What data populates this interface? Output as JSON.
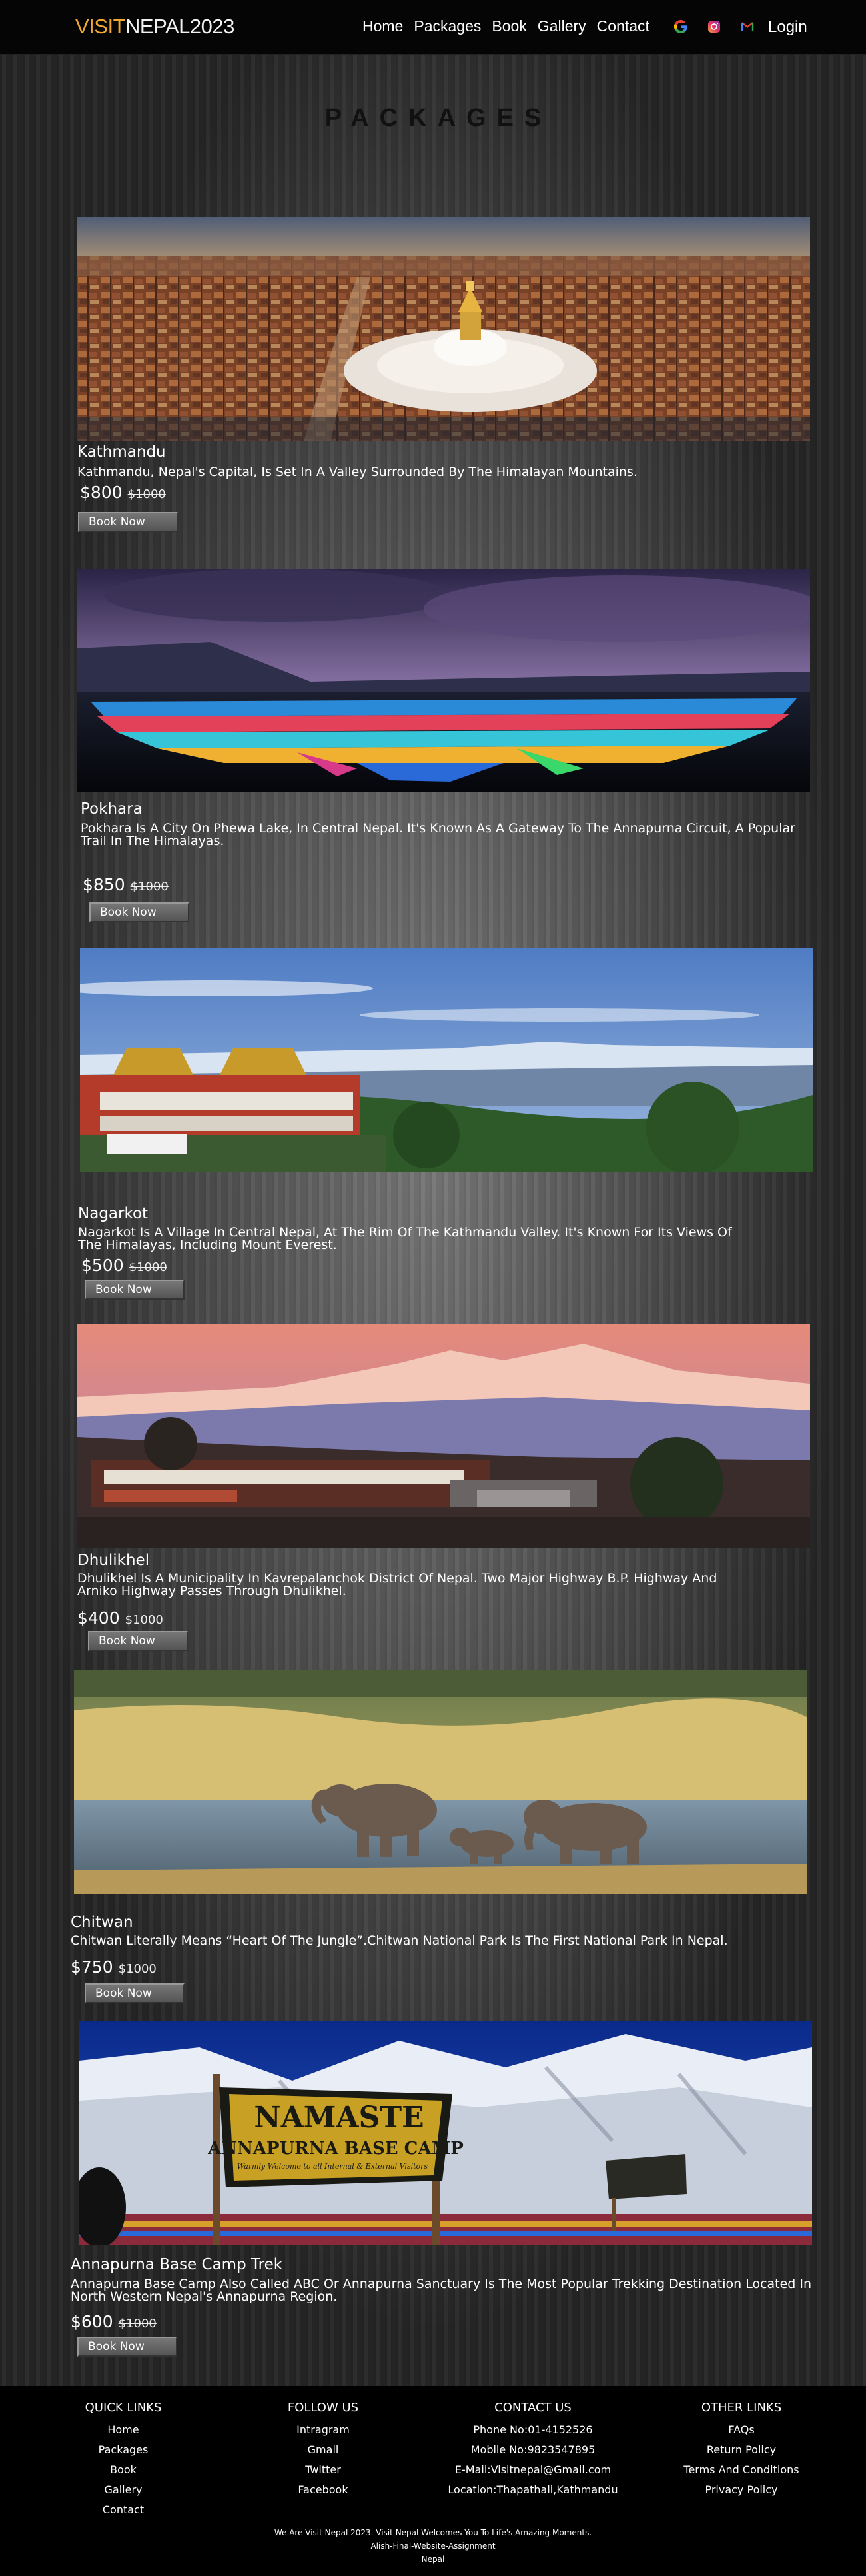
{
  "header": {
    "logo_accent": "VISIT",
    "logo_rest": "NEPAL2023",
    "nav": [
      "Home",
      "Packages",
      "Book",
      "Gallery",
      "Contact"
    ],
    "login": "Login",
    "icons": [
      "google-icon",
      "instagram-icon",
      "gmail-icon"
    ]
  },
  "title": "PACKAGES",
  "packages": [
    {
      "name": "Kathmandu",
      "desc": "Kathmandu, Nepal's Capital, Is Set In A Valley Surrounded By The Himalayan Mountains.",
      "price": "$800",
      "old_price": "$1000",
      "button": "Book Now",
      "image": "kathmandu-stupa-photo"
    },
    {
      "name": "Pokhara",
      "desc": "Pokhara Is A City On Phewa Lake, In Central Nepal. It's Known As A Gateway To The Annapurna Circuit, A Popular Trail In The Himalayas.",
      "price": "$850",
      "old_price": "$1000",
      "button": "Book Now",
      "image": "pokhara-boats-photo"
    },
    {
      "name": "Nagarkot",
      "desc": "Nagarkot Is A Village In Central Nepal, At The Rim Of The Kathmandu Valley. It's Known For Its Views Of The Himalayas, Including Mount Everest.",
      "price": "$500",
      "old_price": "$1000",
      "button": "Book Now",
      "image": "nagarkot-monastery-photo"
    },
    {
      "name": "Dhulikhel",
      "desc": "Dhulikhel Is A Municipality In Kavrepalanchok District Of Nepal. Two Major Highway B.P. Highway And Arniko Highway Passes Through Dhulikhel.",
      "price": "$400",
      "old_price": "$1000",
      "button": "Book Now",
      "image": "dhulikhel-village-photo"
    },
    {
      "name": "Chitwan",
      "desc": "Chitwan Literally Means “Heart Of The Jungle”.Chitwan National Park Is The First National Park In Nepal.",
      "price": "$750",
      "old_price": "$1000",
      "button": "Book Now",
      "image": "chitwan-elephants-photo"
    },
    {
      "name": "Annapurna Base Camp Trek",
      "desc": "Annapurna Base Camp Also Called ABC Or Annapurna Sanctuary Is The Most Popular Trekking Destination Located In North Western Nepal's Annapurna Region.",
      "price": "$600",
      "old_price": "$1000",
      "button": "Book Now",
      "image": "annapurna-sign-photo"
    }
  ],
  "annapurna_sign": {
    "line1": "NAMASTE",
    "line2": "ANNAPURNA BASE CAMP",
    "line3": "Warmly Welcome to all Internal & External Visitors"
  },
  "footer": {
    "quick_links": {
      "title": "QUICK LINKS",
      "items": [
        "Home",
        "Packages",
        "Book",
        "Gallery",
        "Contact"
      ]
    },
    "follow_us": {
      "title": "FOLLOW US",
      "items": [
        "Intragram",
        "Gmail",
        "Twitter",
        "Facebook"
      ]
    },
    "contact_us": {
      "title": "CONTACT US",
      "items": [
        "Phone No:01-4152526",
        "Mobile No:9823547895",
        "E-Mail:Visitnepal@Gmail.com",
        "Location:Thapathali,Kathmandu"
      ]
    },
    "other_links": {
      "title": "OTHER LINKS",
      "items": [
        "FAQs",
        "Return Policy",
        "Terms And Conditions",
        "Privacy Policy"
      ]
    },
    "bottom": [
      "We Are Visit Nepal 2023. Visit Nepal Welcomes You To Life's Amazing Moments.",
      "Alish-Final-Website-Assignment",
      "Nepal"
    ]
  }
}
